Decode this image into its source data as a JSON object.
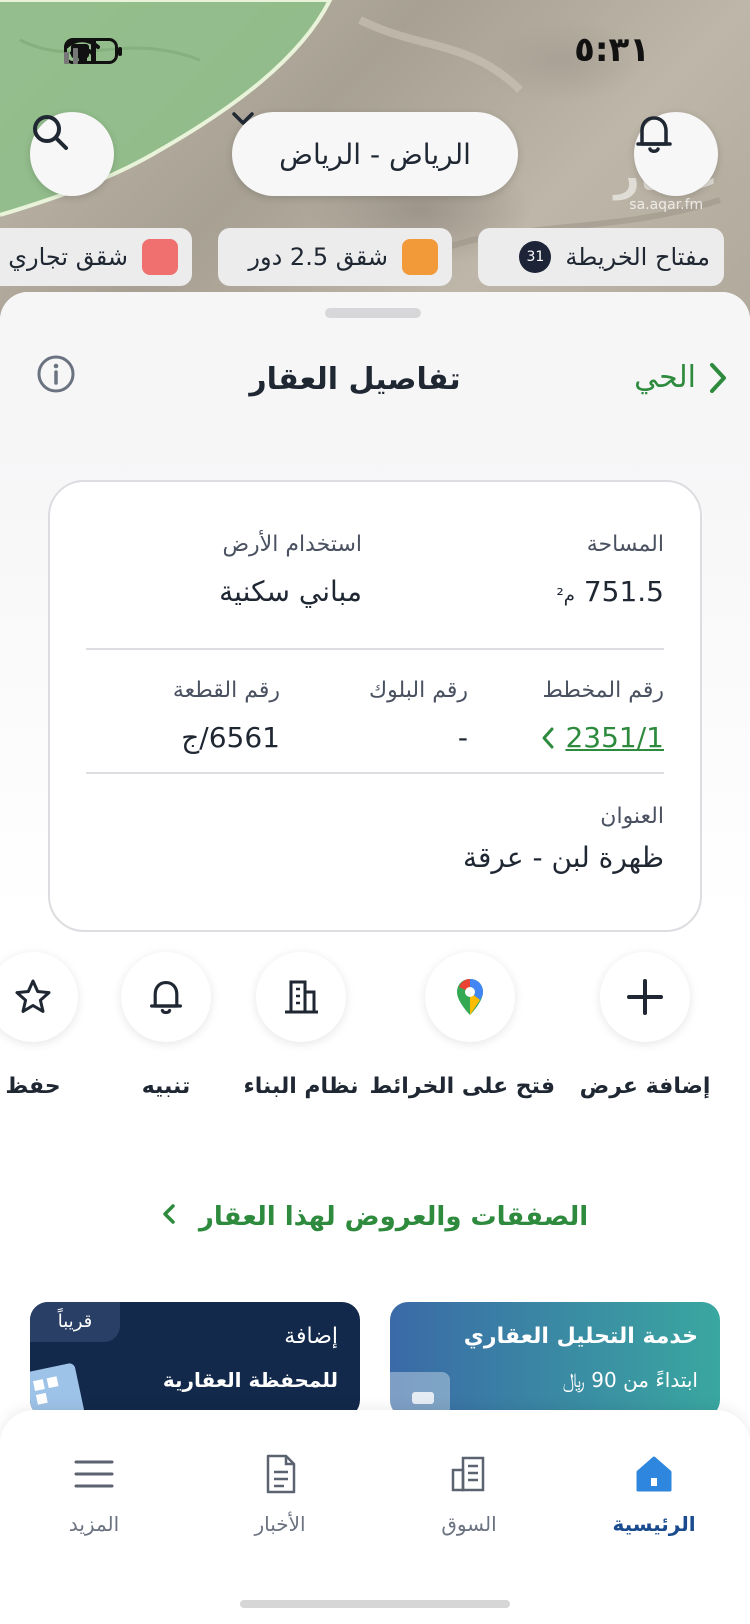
{
  "status_bar": {
    "time": "٥:٣١"
  },
  "header": {
    "city_label": "الرياض - الرياض",
    "watermark_logo": "عقار",
    "watermark_url": "sa.aqar.fm"
  },
  "chips": [
    {
      "label": "مفتاح الخريطة",
      "count": "31"
    },
    {
      "label": "شقق 2.5 دور",
      "color": "#f29a3a"
    },
    {
      "label": "شقق تجاري",
      "color": "#f07070"
    }
  ],
  "sheet": {
    "title": "تفاصيل العقار",
    "back_label": "الحي"
  },
  "details": {
    "area_label": "المساحة",
    "area_value": "751.5",
    "area_unit": "م²",
    "land_use_label": "استخدام الأرض",
    "land_use_value": "مباني سكنية",
    "plan_label": "رقم المخطط",
    "plan_value": "2351/1",
    "block_label": "رقم البلوك",
    "block_value": "-",
    "plot_label": "رقم القطعة",
    "plot_value": "6561/ج",
    "address_label": "العنوان",
    "address_value": "ظهرة لبن - عرقة"
  },
  "actions": [
    {
      "label": "إضافة عرض",
      "icon": "plus-icon"
    },
    {
      "label": "فتح على الخرائط",
      "icon": "map-pin-icon"
    },
    {
      "label": "نظام البناء",
      "icon": "building-icon"
    },
    {
      "label": "تنبيه",
      "icon": "bell-icon"
    },
    {
      "label": "حفظ",
      "icon": "star-icon"
    }
  ],
  "deals_link": "الصفقات والعروض لهذا العقار",
  "banners": [
    {
      "title": "خدمة التحليل العقاري",
      "subtitle": "ابتداءً من 90 ﷼"
    },
    {
      "title": "إضافة",
      "subtitle": "للمحفظة العقارية",
      "badge": "قريباً"
    }
  ],
  "nav": [
    {
      "label": "الرئيسية",
      "icon": "home-icon"
    },
    {
      "label": "السوق",
      "icon": "market-icon"
    },
    {
      "label": "الأخبار",
      "icon": "news-icon"
    },
    {
      "label": "المزيد",
      "icon": "menu-icon"
    }
  ],
  "colors": {
    "accent_green": "#2e8b3e",
    "nav_active": "#1a4b8f",
    "banner_dark": "#13294b"
  }
}
